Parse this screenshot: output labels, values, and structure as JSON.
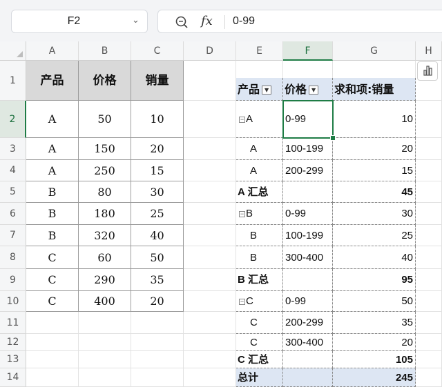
{
  "namebox": {
    "value": "F2",
    "arrow_icon": "chevron-down-icon"
  },
  "formula_bar": {
    "zoom_icon": "zoom-formula-icon",
    "fx_label": "fx",
    "value": "0-99"
  },
  "columns": [
    "A",
    "B",
    "C",
    "D",
    "E",
    "F",
    "G",
    "H"
  ],
  "rows": [
    "1",
    "2",
    "3",
    "4",
    "5",
    "6",
    "7",
    "8",
    "9",
    "10",
    "11",
    "12",
    "13",
    "14"
  ],
  "selected": {
    "column": "F",
    "row": "2"
  },
  "source_table": {
    "headers": [
      "产品",
      "价格",
      "销量"
    ],
    "rows": [
      [
        "A",
        "50",
        "10"
      ],
      [
        "A",
        "150",
        "20"
      ],
      [
        "A",
        "250",
        "15"
      ],
      [
        "B",
        "80",
        "30"
      ],
      [
        "B",
        "180",
        "25"
      ],
      [
        "B",
        "320",
        "40"
      ],
      [
        "C",
        "60",
        "50"
      ],
      [
        "C",
        "290",
        "35"
      ],
      [
        "C",
        "400",
        "20"
      ]
    ]
  },
  "pivot": {
    "headers": {
      "product": "产品",
      "price": "价格",
      "sum": "求和项:销量"
    },
    "rows": [
      {
        "product": "A",
        "price": "0-99",
        "value": "10",
        "collapse": "⊟"
      },
      {
        "product": "A",
        "price": "100-199",
        "value": "20"
      },
      {
        "product": "A",
        "price": "200-299",
        "value": "15"
      },
      {
        "product": "A 汇总",
        "price": "",
        "value": "45",
        "subtotal": true
      },
      {
        "product": "B",
        "price": "0-99",
        "value": "30",
        "collapse": "⊟"
      },
      {
        "product": "B",
        "price": "100-199",
        "value": "25"
      },
      {
        "product": "B",
        "price": "300-400",
        "value": "40"
      },
      {
        "product": "B 汇总",
        "price": "",
        "value": "95",
        "subtotal": true
      },
      {
        "product": "C",
        "price": "0-99",
        "value": "50",
        "collapse": "⊟"
      },
      {
        "product": "C",
        "price": "200-299",
        "value": "35"
      },
      {
        "product": "C",
        "price": "300-400",
        "value": "20"
      },
      {
        "product": "C 汇总",
        "price": "",
        "value": "105",
        "subtotal": true
      },
      {
        "product": "总计",
        "price": "",
        "value": "245",
        "total": true
      }
    ]
  },
  "icons": {
    "filter": "filter-dropdown-icon",
    "quick_analysis": "chart-icon"
  },
  "colors": {
    "accent": "#1e7c45",
    "pivot_header": "#dde6f3",
    "source_header": "#d9d9d9"
  }
}
